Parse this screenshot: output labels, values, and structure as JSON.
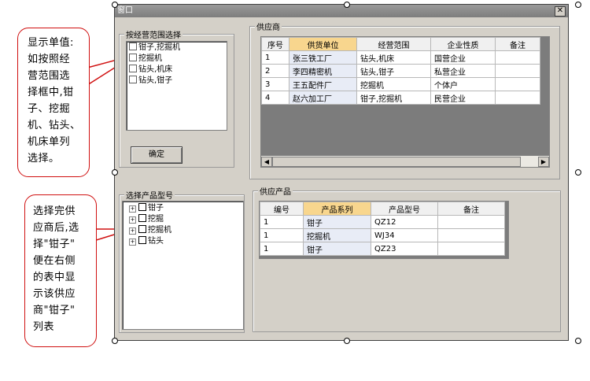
{
  "window": {
    "title": "窗口",
    "close_label": "✕"
  },
  "scope_group": {
    "label": "按经营范围选择",
    "items": [
      "钳子,挖掘机",
      "挖掘机",
      "钻头,机床",
      "钻头,钳子"
    ],
    "confirm_label": "确定"
  },
  "supplier_group": {
    "label": "供应商",
    "columns": [
      "序号",
      "供货单位",
      "经营范围",
      "企业性质",
      "备注"
    ],
    "rows": [
      [
        "1",
        "张三铁工厂",
        "钻头,机床",
        "国营企业",
        ""
      ],
      [
        "2",
        "李四精密机",
        "钻头,钳子",
        "私营企业",
        ""
      ],
      [
        "3",
        "王五配件厂",
        "挖掘机",
        "个体户",
        ""
      ],
      [
        "4",
        "赵六加工厂",
        "钳子,挖掘机",
        "民营企业",
        ""
      ]
    ]
  },
  "product_type_group": {
    "label": "选择产品型号",
    "tree": [
      "钳子",
      "挖掘",
      "挖掘机",
      "钻头"
    ]
  },
  "product_group": {
    "label": "供应产品",
    "columns": [
      "编号",
      "产品系列",
      "产品型号",
      "备注"
    ],
    "rows": [
      [
        "1",
        "钳子",
        "QZ12",
        ""
      ],
      [
        "1",
        "挖掘机",
        "WJ34",
        ""
      ],
      [
        "1",
        "钳子",
        "QZ23",
        ""
      ]
    ]
  },
  "callouts": {
    "top": [
      "显示单值:",
      "如按照经",
      "营范围选",
      "择框中,钳",
      "子、挖掘",
      "机、钻头、",
      "机床单列",
      "选择。"
    ],
    "bottom": [
      "选择完供",
      "应商后,选",
      "择\"钳子\"",
      "便在右侧",
      "的表中显",
      "示该供应",
      "商\"钳子\"",
      "列表"
    ]
  }
}
